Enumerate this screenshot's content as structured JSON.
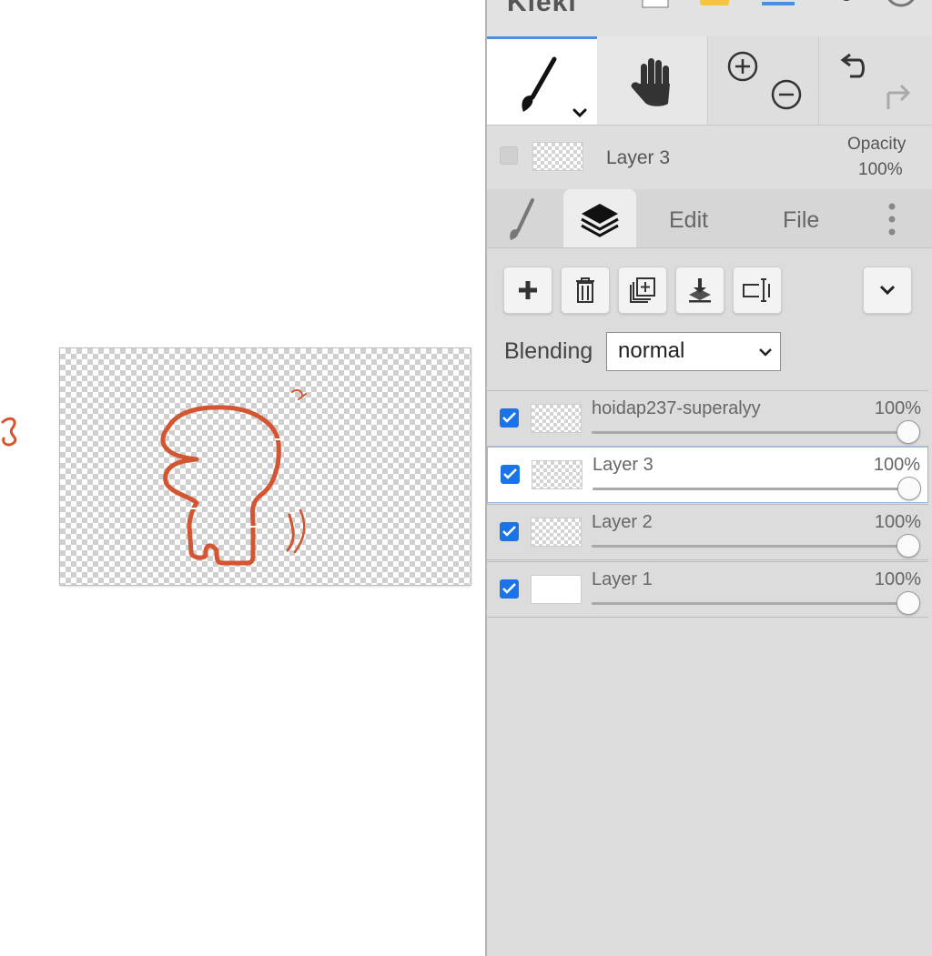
{
  "app": {
    "title": "Kleki"
  },
  "colors": {
    "accent": "#1a73e8",
    "stroke": "#d9532c",
    "panel_bg": "#dcdcdc"
  },
  "toolbar": {
    "tools": [
      {
        "name": "brush",
        "icon": "brush-icon",
        "active": true
      },
      {
        "name": "hand",
        "icon": "hand-icon",
        "active": false
      },
      {
        "name": "zoom",
        "icon": "zoom-icon",
        "active": false
      },
      {
        "name": "undo-redo",
        "icon": "undo-icon",
        "active": false
      }
    ]
  },
  "current_layer": {
    "name": "Layer 3",
    "opacity_label": "Opacity",
    "opacity_value": "100%"
  },
  "tabs": {
    "edit_label": "Edit",
    "file_label": "File"
  },
  "layer_actions": [
    "add-layer",
    "delete-layer",
    "duplicate-layer",
    "merge-down",
    "rename-layer"
  ],
  "blending": {
    "label": "Blending",
    "value": "normal"
  },
  "layers": [
    {
      "name": "hoidap237-superalyy",
      "opacity": "100%",
      "visible": true,
      "active": false,
      "opacity_value": 1.0
    },
    {
      "name": "Layer 3",
      "opacity": "100%",
      "visible": true,
      "active": true,
      "opacity_value": 1.0
    },
    {
      "name": "Layer 2",
      "opacity": "100%",
      "visible": true,
      "active": false,
      "opacity_value": 1.0
    },
    {
      "name": "Layer 1",
      "opacity": "100%",
      "visible": true,
      "active": false,
      "opacity_value": 1.0
    }
  ]
}
